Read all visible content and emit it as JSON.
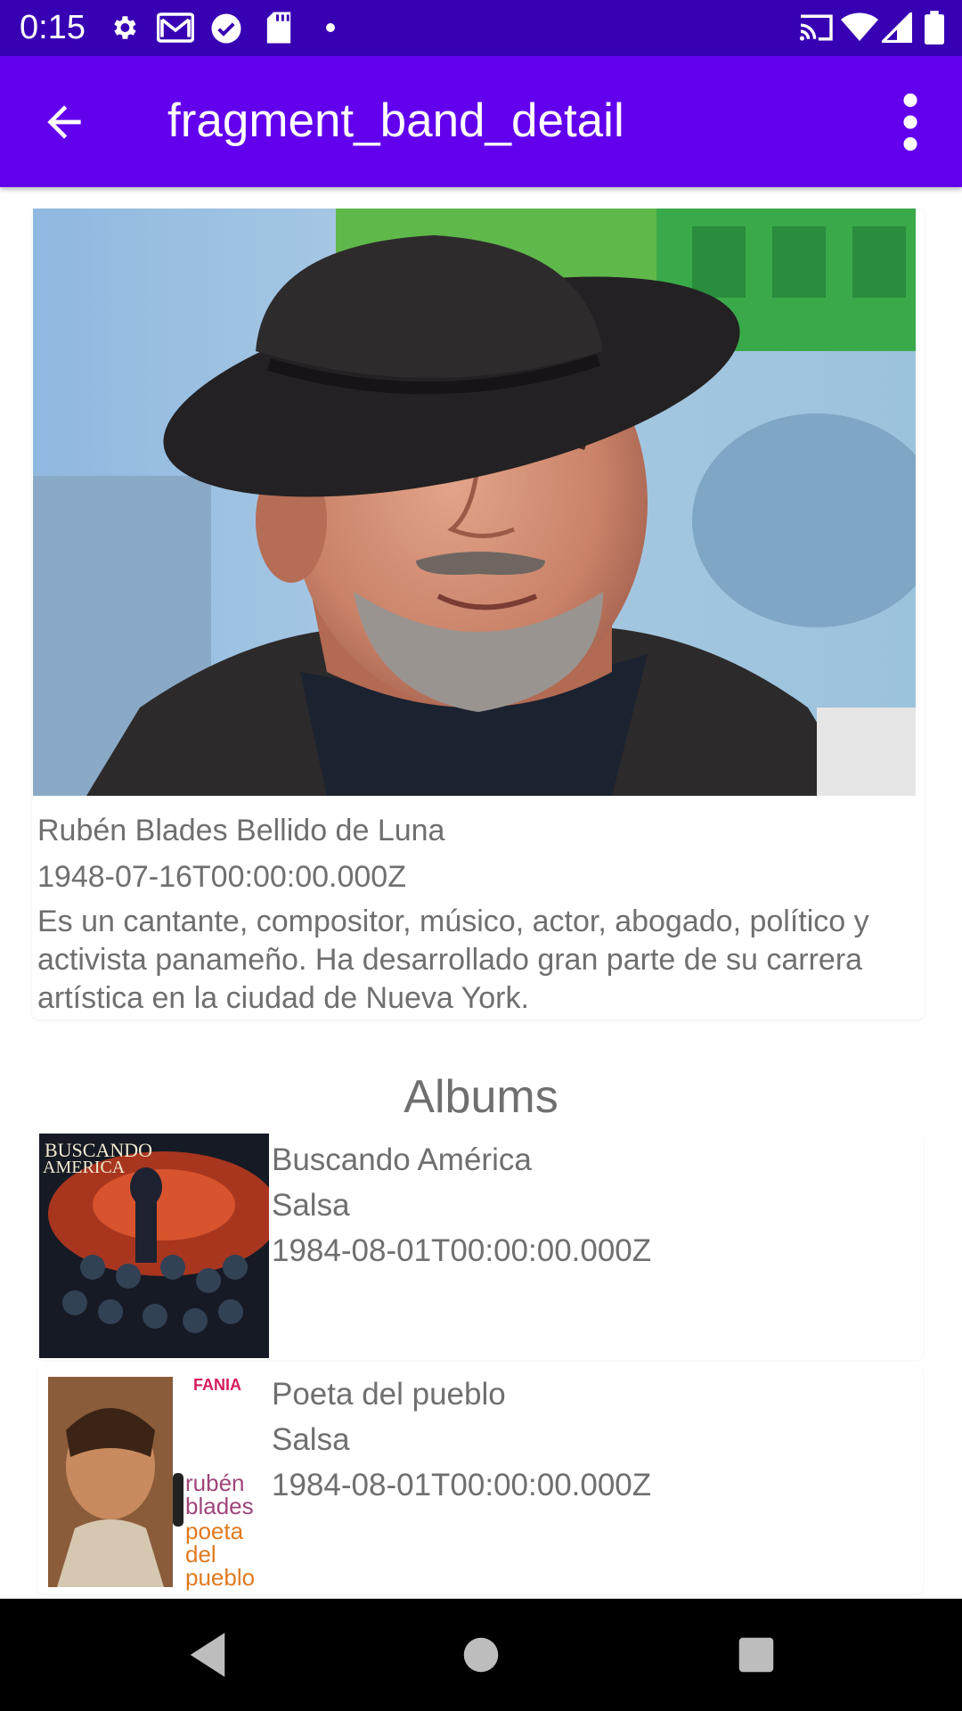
{
  "status_bar": {
    "time": "0:15",
    "icons_left": [
      "settings-icon",
      "gmail-icon",
      "check-circle-icon",
      "sd-card-icon",
      "dot-icon"
    ],
    "icons_right": [
      "cast-icon",
      "wifi-icon",
      "signal-icon",
      "battery-icon"
    ]
  },
  "app_bar": {
    "title": "fragment_band_detail",
    "back_icon": "arrow-back-icon",
    "menu_icon": "more-vert-icon",
    "color": "#6200EE",
    "status_color": "#3700B3"
  },
  "band": {
    "name": "Rubén Blades Bellido de Luna",
    "birth_date": "1948-07-16T00:00:00.000Z",
    "description": "Es un cantante, compositor, músico, actor, abogado, político y activista panameño. Ha desarrollado gran parte de su carrera artística en la ciudad de Nueva York."
  },
  "albums": {
    "title": "Albums",
    "items": [
      {
        "name": "Buscando América",
        "genre": "Salsa",
        "release_date": "1984-08-01T00:00:00.000Z",
        "cover_text": [
          "BUSCANDO",
          "AMERICA"
        ]
      },
      {
        "name": "Poeta del pueblo",
        "genre": "Salsa",
        "release_date": "1984-08-01T00:00:00.000Z",
        "cover_text": [
          "FANIA",
          "rubén",
          "blades",
          "poeta",
          "del",
          "pueblo"
        ]
      }
    ]
  },
  "nav_bar": {
    "buttons": [
      "back-triangle-icon",
      "home-circle-icon",
      "recents-square-icon"
    ]
  }
}
